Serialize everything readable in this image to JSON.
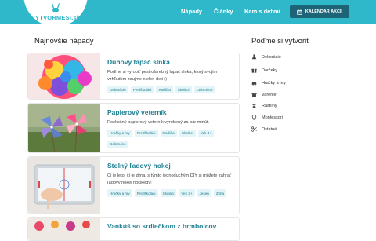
{
  "header": {
    "logo_text": "VYTVORMESI.sk",
    "nav": [
      "Nápady",
      "Články",
      "Kam s deťmi"
    ],
    "calendar_button": "KALENDÁR AKCIÍ"
  },
  "main": {
    "section_title": "Najnovšie nápady",
    "cards": [
      {
        "title": "Dúhový tapač slnka",
        "description": "Poďme si vyrobiť pestrofarebný lapač slnka, ktorý svojim vzhľadom zaujme nielen deti :)",
        "tags": [
          "Dekorácie",
          "Predškoláci",
          "Rodičia",
          "Školáci",
          "Celoročne"
        ],
        "image": "rainbow-suncatcher-photo"
      },
      {
        "title": "Papierový veterník",
        "description": "Rozkošný papierový veterník vyrobený za pár minút.",
        "tags": [
          "Hračky a hry",
          "Predškoláci",
          "Rodičia",
          "Školáci",
          "Vek 3+",
          "Celoročne"
        ],
        "image": "paper-pinwheel-photo"
      },
      {
        "title": "Stolný ľadový hokej",
        "description": "Či je leto, či je zima, s týmto jednoduchým DIY si môžete zahrať ľadový hokej hocikedy!",
        "tags": [
          "Hračky a hry",
          "Predškoláci",
          "Školáci",
          "Vek 3+",
          "Jeseň",
          "Zima"
        ],
        "image": "ice-hockey-photo"
      },
      {
        "title": "Vankúš so srdiečkom z brmbolcov",
        "description": "",
        "tags": [],
        "image": "pompom-pillow-photo"
      }
    ]
  },
  "sidebar": {
    "title": "Poďme si vytvoriť",
    "items": [
      {
        "label": "Dekorácie",
        "icon": "flask-icon"
      },
      {
        "label": "Darčeky",
        "icon": "gift-icon"
      },
      {
        "label": "Hračky a hry",
        "icon": "car-icon"
      },
      {
        "label": "Varenie",
        "icon": "pot-icon"
      },
      {
        "label": "Rastliny",
        "icon": "plant-icon"
      },
      {
        "label": "Montessori",
        "icon": "lightbulb-icon"
      },
      {
        "label": "Ostatné",
        "icon": "scissors-icon"
      }
    ]
  },
  "colors": {
    "header": "#2fb8c9",
    "button": "#1d6477",
    "card_title": "#1f7f92",
    "tag_bg": "#e3f5f8"
  }
}
